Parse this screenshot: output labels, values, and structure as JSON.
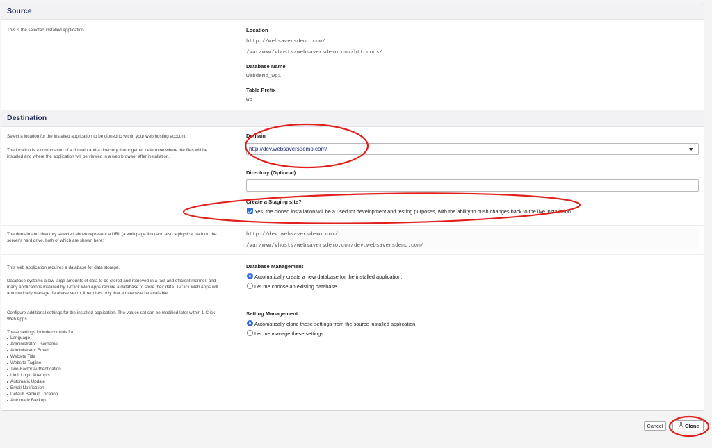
{
  "source": {
    "heading": "Source",
    "description": "This is the selected installed application.",
    "location_label": "Location",
    "location_url": "http://websaversdemo.com/",
    "location_path": "/var/www/vhosts/websaversdemo.com/httpdocs/",
    "db_name_label": "Database Name",
    "db_name_value": "webdemo_wp1",
    "prefix_label": "Table Prefix",
    "prefix_value": "wp_"
  },
  "destination": {
    "heading": "Destination",
    "desc_1": "Select a location for the installed application to be cloned to within your web hosting account.",
    "desc_2a": "The location is a combination of a domain and a directory that together determine where the files will be",
    "desc_2b": "installed and where the application will be viewed in a web browser after installation.",
    "domain_label": "Domain",
    "domain_value": "http://dev.websaversdemo.com/",
    "directory_label": "Directory (Optional)",
    "directory_value": "",
    "staging_label": "Create a Staging site?",
    "staging_checked": true,
    "staging_text": "Yes, the cloned installation will be a used for development and testing purposes, with the ability to push changes back to the live installation."
  },
  "url_info": {
    "desc_a": "The domain and directory selected above represent a URL (a web page link) and also a physical path on the",
    "desc_b": "server's hard drive, both of which are shown here:",
    "url": "http://dev.websaversdemo.com/",
    "path": "/var/www/vhosts/websaversdemo.com/dev.websaversdemo.com/"
  },
  "database": {
    "desc_1": "This web application requires a database for data storage.",
    "desc_2a": "Database systems allow large amounts of data to be stored and retrieved in a fast and efficient manner, and",
    "desc_2b": "many applications installed by 1-Click Web Apps require a database to store their data. 1-Click Web Apps will",
    "desc_2c": "automatically manage database setup, it requires only that a database be available.",
    "label": "Database Management",
    "option_auto": "Automatically create a new database for the installed application.",
    "option_existing": "Let me choose an existing database.",
    "selected": "auto"
  },
  "settings": {
    "desc_1a": "Configure additional settings for the installed application. The values set can be modified later within 1-Click",
    "desc_1b": "Web Apps.",
    "desc_2": "These settings include controls for:",
    "items": [
      "Language",
      "Administrator Username",
      "Administrator Email",
      "Website Title",
      "Website Tagline",
      "Two-Factor Authentication",
      "Limit Login Attempts",
      "Automatic Update",
      "Email Notification",
      "Default Backup Location",
      "Automatic Backup"
    ],
    "label": "Setting Management",
    "option_auto": "Automatically clone these settings from the source installed application.",
    "option_manual": "Let me manage these settings.",
    "selected": "auto"
  },
  "actions": {
    "cancel_label": "Cancel",
    "clone_label": "Clone"
  },
  "colors": {
    "heading": "#27305a",
    "accent": "#2f6fd6",
    "annotation": "#e0201c"
  },
  "icons": {
    "clone_button": "flask-icon",
    "domain_select": "chevron-down-icon",
    "staging": "checkbox-checked-icon"
  }
}
